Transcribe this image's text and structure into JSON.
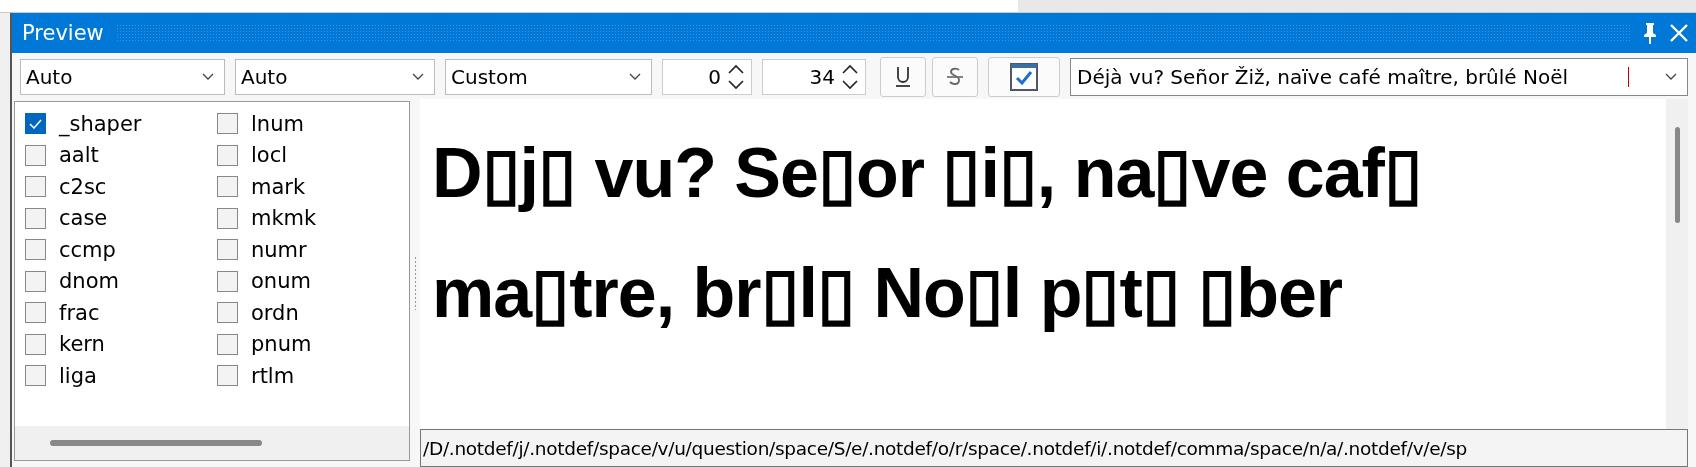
{
  "window": {
    "title": "Preview"
  },
  "toolbar": {
    "dropdowns": [
      {
        "value": "Auto"
      },
      {
        "value": "Auto"
      },
      {
        "value": "Custom"
      }
    ],
    "spinners": [
      {
        "value": "0"
      },
      {
        "value": "34"
      }
    ],
    "sample_text": {
      "value": "Déjà vu? Señor Žiž, naïve café maître, brûlé Noël"
    }
  },
  "features": [
    {
      "label": "_shaper",
      "checked": true
    },
    {
      "label": "aalt",
      "checked": false
    },
    {
      "label": "c2sc",
      "checked": false
    },
    {
      "label": "case",
      "checked": false
    },
    {
      "label": "ccmp",
      "checked": false
    },
    {
      "label": "dnom",
      "checked": false
    },
    {
      "label": "frac",
      "checked": false
    },
    {
      "label": "kern",
      "checked": false
    },
    {
      "label": "liga",
      "checked": false
    },
    {
      "label": "lnum",
      "checked": false
    },
    {
      "label": "locl",
      "checked": false
    },
    {
      "label": "mark",
      "checked": false
    },
    {
      "label": "mkmk",
      "checked": false
    },
    {
      "label": "numr",
      "checked": false
    },
    {
      "label": "onum",
      "checked": false
    },
    {
      "label": "ordn",
      "checked": false
    },
    {
      "label": "pnum",
      "checked": false
    },
    {
      "label": "rtlm",
      "checked": false
    }
  ],
  "preview": {
    "text": "D▯j▯ vu? Se▯or ▯i▯, na▯ve caf▯ ma▯tre, br▯l▯ No▯l p▯t▯ ▯ber"
  },
  "glyph_names": "/D/.notdef/j/.notdef/space/v/u/question/space/S/e/.notdef/o/r/space/.notdef/i/.notdef/comma/space/n/a/.notdef/v/e/sp"
}
